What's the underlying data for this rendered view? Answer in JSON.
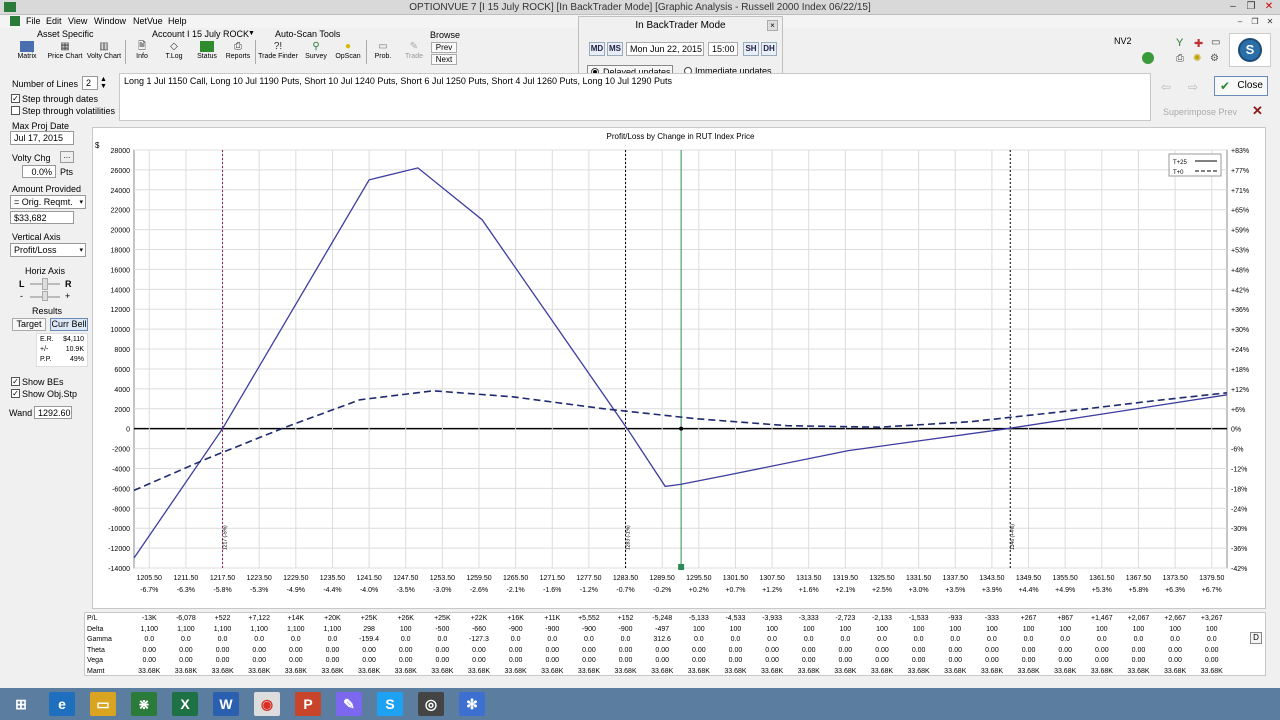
{
  "window": {
    "title": "OPTIONVUE 7    [I 15 July ROCK]   [In BackTrader Mode]   [Graphic Analysis - Russell 2000 Index  06/22/15]"
  },
  "menu": [
    "File",
    "Edit",
    "View",
    "Window",
    "NetVue",
    "Help"
  ],
  "toolbar": {
    "asset_specific": "Asset Specific",
    "account": "Account I 15 July ROCK",
    "auto_scan": "Auto-Scan Tools",
    "browse": "Browse",
    "prev": "Prev",
    "next": "Next",
    "buttons": [
      "Matrix",
      "Price Chart",
      "Volty Chart",
      "Info",
      "T.Log",
      "Status",
      "Reports",
      "Trade Finder",
      "Survey",
      "OpScan",
      "Prob.",
      "Trade"
    ],
    "nv2": "NV2"
  },
  "backtrader": {
    "title": "In BackTrader Mode",
    "md": "MD",
    "ms": "MS",
    "date": "Mon Jun 22, 2015",
    "time": "15:00",
    "sh": "SH",
    "dh": "DH",
    "delayed": "Delayed updates",
    "immediate": "Immediate updates"
  },
  "left_panel": {
    "num_lines_label": "Number of Lines",
    "num_lines": "2",
    "step_dates": "Step through dates",
    "step_vols": "Step through volatilities",
    "max_proj_label": "Max Proj Date",
    "max_proj": "Jul 17, 2015",
    "volty_label": "Volty Chg",
    "volty_value": "0.0%",
    "volty_unit": "Pts",
    "amount_label": "Amount Provided",
    "amount_select": "= Orig. Reqmt.",
    "amount_value": "$33,682",
    "vaxis_label": "Vertical Axis",
    "vaxis_value": "Profit/Loss",
    "haxis_label": "Horiz Axis",
    "l": "L",
    "r": "R",
    "minus": "-",
    "plus": "+",
    "results_label": "Results",
    "target": "Target",
    "curr_bell": "Curr Bell",
    "er_label": "E.R.",
    "er_value": "$4,110",
    "pm_label": "+/-",
    "pm_value": "10.9K",
    "pp_label": "P.P.",
    "pp_value": "49%",
    "show_bes": "Show BEs",
    "show_obj": "Show Obj.Stp",
    "wand_label": "Wand",
    "wand_value": "1292.60"
  },
  "command_text": "Long 1 Jul 1150 Call, Long 10 Jul 1190 Puts, Short 10 Jul 1240 Puts, Short 6 Jul 1250 Puts, Short 4 Jul 1260 Puts, Long 10 Jul 1290 Puts",
  "right_controls": {
    "close": "Close",
    "superimpose": "Superimpose Prev"
  },
  "chart_data": {
    "type": "line",
    "title": "Profit/Loss by Change in RUT Index Price",
    "ylabel_top": "$",
    "y_ticks": [
      28000,
      26000,
      24000,
      22000,
      20000,
      18000,
      16000,
      14000,
      12000,
      10000,
      8000,
      6000,
      4000,
      2000,
      0,
      -2000,
      -4000,
      -6000,
      -8000,
      -10000,
      -12000,
      -14000
    ],
    "ylim": [
      -14000,
      28000
    ],
    "pct_ticks": [
      "+83%",
      "+77%",
      "+71%",
      "+65%",
      "+59%",
      "+53%",
      "+48%",
      "+42%",
      "+36%",
      "+30%",
      "+24%",
      "+18%",
      "+12%",
      "+6%",
      "0%",
      "-6%",
      "-12%",
      "-18%",
      "-24%",
      "-30%",
      "-36%",
      "-42%"
    ],
    "x_ticks": [
      "1205.50",
      "1211.50",
      "1217.50",
      "1223.50",
      "1229.50",
      "1235.50",
      "1241.50",
      "1247.50",
      "1253.50",
      "1259.50",
      "1265.50",
      "1271.50",
      "1277.50",
      "1283.50",
      "1289.50",
      "1295.50",
      "1301.50",
      "1307.50",
      "1313.50",
      "1319.50",
      "1325.50",
      "1331.50",
      "1337.50",
      "1343.50",
      "1349.50",
      "1355.50",
      "1361.50",
      "1367.50",
      "1373.50",
      "1379.50"
    ],
    "x_pct": [
      "-6.7%",
      "-6.3%",
      "-5.8%",
      "-5.3%",
      "-4.9%",
      "-4.4%",
      "-4.0%",
      "-3.5%",
      "-3.0%",
      "-2.6%",
      "-2.1%",
      "-1.6%",
      "-1.2%",
      "-0.7%",
      "-0.2%",
      "+0.2%",
      "+0.7%",
      "+1.2%",
      "+1.6%",
      "+2.1%",
      "+2.5%",
      "+3.0%",
      "+3.5%",
      "+3.9%",
      "+4.4%",
      "+4.9%",
      "+5.3%",
      "+5.8%",
      "+6.3%",
      "+6.7%"
    ],
    "xlim": [
      1203,
      1382
    ],
    "series": [
      {
        "name": "T+25",
        "style": "solid",
        "color": "#3c3ca0",
        "points": [
          [
            1203,
            -13000
          ],
          [
            1217.5,
            0
          ],
          [
            1241.5,
            25000
          ],
          [
            1249.5,
            26200
          ],
          [
            1260,
            21000
          ],
          [
            1284,
            -200
          ],
          [
            1290,
            -5800
          ],
          [
            1292.5,
            -5600
          ],
          [
            1300,
            -4700
          ],
          [
            1320,
            -2200
          ],
          [
            1346,
            0
          ],
          [
            1382,
            3400
          ]
        ]
      },
      {
        "name": "T+0",
        "style": "dashed",
        "color": "#1e2a6e",
        "points": [
          [
            1203,
            -6200
          ],
          [
            1215,
            -3000
          ],
          [
            1228,
            200
          ],
          [
            1240,
            2900
          ],
          [
            1252,
            3800
          ],
          [
            1265,
            3200
          ],
          [
            1280,
            2000
          ],
          [
            1295,
            1000
          ],
          [
            1310,
            300
          ],
          [
            1325,
            150
          ],
          [
            1340,
            700
          ],
          [
            1355,
            1700
          ],
          [
            1370,
            2800
          ],
          [
            1382,
            3600
          ]
        ]
      }
    ],
    "breakevens": [
      {
        "x": 1217.5,
        "label": "1217 (-5%)"
      },
      {
        "x": 1283.5,
        "label": "1283 (-1%)"
      },
      {
        "x": 1346.5,
        "label": "1346 (+4%)"
      }
    ],
    "current_price": 1292.6,
    "legend": [
      "T+25",
      "T+0"
    ],
    "legend_position": "top-right",
    "grid": true
  },
  "greeks": {
    "rows": [
      {
        "label": "P/L",
        "values": [
          "-13K",
          "-6,078",
          "+522",
          "+7,122",
          "+14K",
          "+20K",
          "+25K",
          "+26K",
          "+25K",
          "+22K",
          "+16K",
          "+11K",
          "+5,552",
          "+152",
          "-5,248",
          "-5,133",
          "-4,533",
          "-3,933",
          "-3,333",
          "-2,723",
          "-2,133",
          "-1,533",
          "-933",
          "-333",
          "+267",
          "+867",
          "+1,467",
          "+2,067",
          "+2,667",
          "+3,267"
        ]
      },
      {
        "label": "Delta",
        "values": [
          "1,100",
          "1,100",
          "1,100",
          "1,100",
          "1,100",
          "1,100",
          "298",
          "100",
          "-500",
          "-660",
          "-900",
          "-900",
          "-900",
          "-900",
          "-497",
          "100",
          "100",
          "100",
          "100",
          "100",
          "100",
          "100",
          "100",
          "100",
          "100",
          "100",
          "100",
          "100",
          "100",
          "100"
        ]
      },
      {
        "label": "Gamma",
        "values": [
          "0.0",
          "0.0",
          "0.0",
          "0.0",
          "0.0",
          "0.0",
          "-159.4",
          "0.0",
          "0.0",
          "-127.3",
          "0.0",
          "0.0",
          "0.0",
          "0.0",
          "312.6",
          "0.0",
          "0.0",
          "0.0",
          "0.0",
          "0.0",
          "0.0",
          "0.0",
          "0.0",
          "0.0",
          "0.0",
          "0.0",
          "0.0",
          "0.0",
          "0.0",
          "0.0"
        ]
      },
      {
        "label": "Theta",
        "values": [
          "0.00",
          "0.00",
          "0.00",
          "0.00",
          "0.00",
          "0.00",
          "0.00",
          "0.00",
          "0.00",
          "0.00",
          "0.00",
          "0.00",
          "0.00",
          "0.00",
          "0.00",
          "0.00",
          "0.00",
          "0.00",
          "0.00",
          "0.00",
          "0.00",
          "0.00",
          "0.00",
          "0.00",
          "0.00",
          "0.00",
          "0.00",
          "0.00",
          "0.00",
          "0.00"
        ]
      },
      {
        "label": "Vega",
        "values": [
          "0.00",
          "0.00",
          "0.00",
          "0.00",
          "0.00",
          "0.00",
          "0.00",
          "0.00",
          "0.00",
          "0.00",
          "0.00",
          "0.00",
          "0.00",
          "0.00",
          "0.00",
          "0.00",
          "0.00",
          "0.00",
          "0.00",
          "0.00",
          "0.00",
          "0.00",
          "0.00",
          "0.00",
          "0.00",
          "0.00",
          "0.00",
          "0.00",
          "0.00",
          "0.00"
        ]
      },
      {
        "label": "Mamt",
        "values": [
          "33.68K",
          "33.68K",
          "33.68K",
          "33.68K",
          "33.68K",
          "33.68K",
          "33.68K",
          "33.68K",
          "33.68K",
          "33.68K",
          "33.68K",
          "33.68K",
          "33.68K",
          "33.68K",
          "33.68K",
          "33.68K",
          "33.68K",
          "33.68K",
          "33.68K",
          "33.68K",
          "33.68K",
          "33.68K",
          "33.68K",
          "33.68K",
          "33.68K",
          "33.68K",
          "33.68K",
          "33.68K",
          "33.68K",
          "33.68K"
        ]
      }
    ],
    "d_button": "D"
  },
  "taskbar": {
    "icons": [
      "windows-start-icon",
      "internet-explorer-icon",
      "file-explorer-icon",
      "optionvue-icon",
      "excel-icon",
      "word-icon",
      "chrome-icon",
      "powerpoint-icon",
      "notepad-icon",
      "skype-icon",
      "camera-icon",
      "snowflake-app-icon"
    ]
  },
  "colors": {
    "pl_line": "#3c3ca0",
    "t0_line": "#1e2a6e",
    "be_line": "#8b1a5a",
    "price_line": "#2e8b57"
  }
}
